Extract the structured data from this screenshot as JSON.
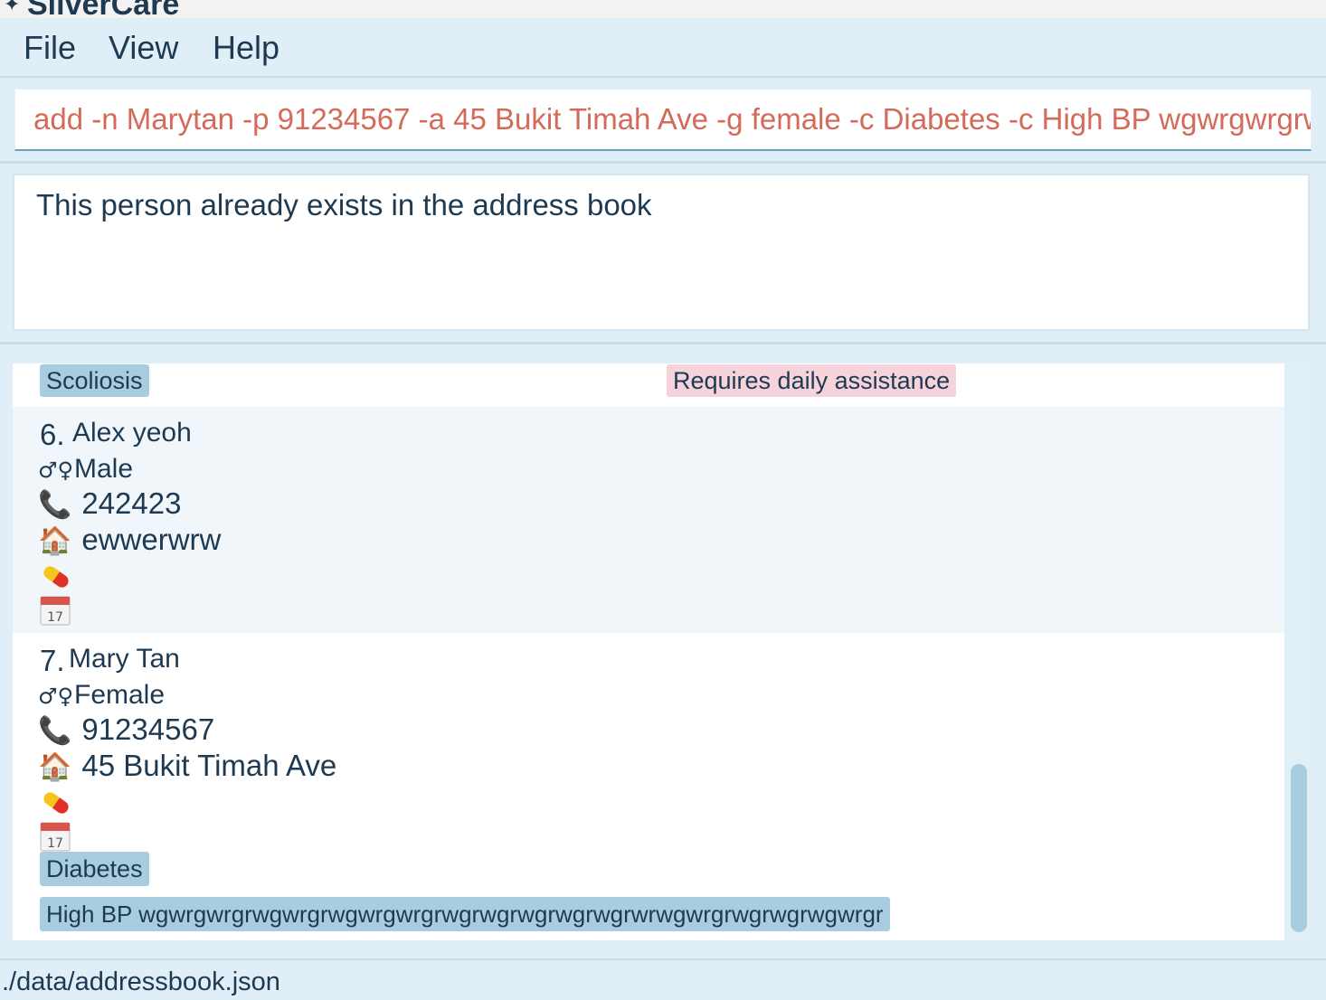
{
  "window": {
    "title": "SilverCare"
  },
  "menu": {
    "file": "File",
    "view": "View",
    "help": "Help"
  },
  "command": {
    "value": "add -n Marytan -p 91234567 -a 45 Bukit Timah Ave -g female -c Diabetes -c High BP wgwrgwrgrwgwrgrwgwrgwrgrwgrwgrwgrwgrwgrwrwgwrgrwgrwgrwgwrgr"
  },
  "result": {
    "message": "This person already exists in the address book"
  },
  "persons": [
    {
      "condition_tags": [
        "Scoliosis"
      ],
      "note_tags": [
        "Requires daily assistance"
      ]
    },
    {
      "index": "6.",
      "name": "Alex yeoh",
      "gender": "Male",
      "phone": "242423",
      "address": "ewwerwrw",
      "condition_tags": [],
      "note_tags": []
    },
    {
      "index": "7.",
      "name": "Mary Tan",
      "gender": "Female",
      "phone": "91234567",
      "address": "45 Bukit Timah Ave",
      "condition_tags": [
        "Diabetes",
        "High BP wgwrgwrgrwgwrgrwgwrgwrgrwgrwgrwgrwgrwgrwrwgwrgrwgrwgrwgwrgr"
      ],
      "note_tags": []
    }
  ],
  "icons": {
    "gender": "♂♀",
    "phone": "📞",
    "address": "🏠",
    "medication": "pill-icon",
    "appointment": "calendar-icon",
    "calendar_day": "17"
  },
  "status": {
    "path": "./data/addressbook.json"
  },
  "colors": {
    "command_text": "#d46a5a",
    "condition_tag": "#a9cde0",
    "note_tag": "#f6d3da",
    "text": "#1e3a52"
  }
}
